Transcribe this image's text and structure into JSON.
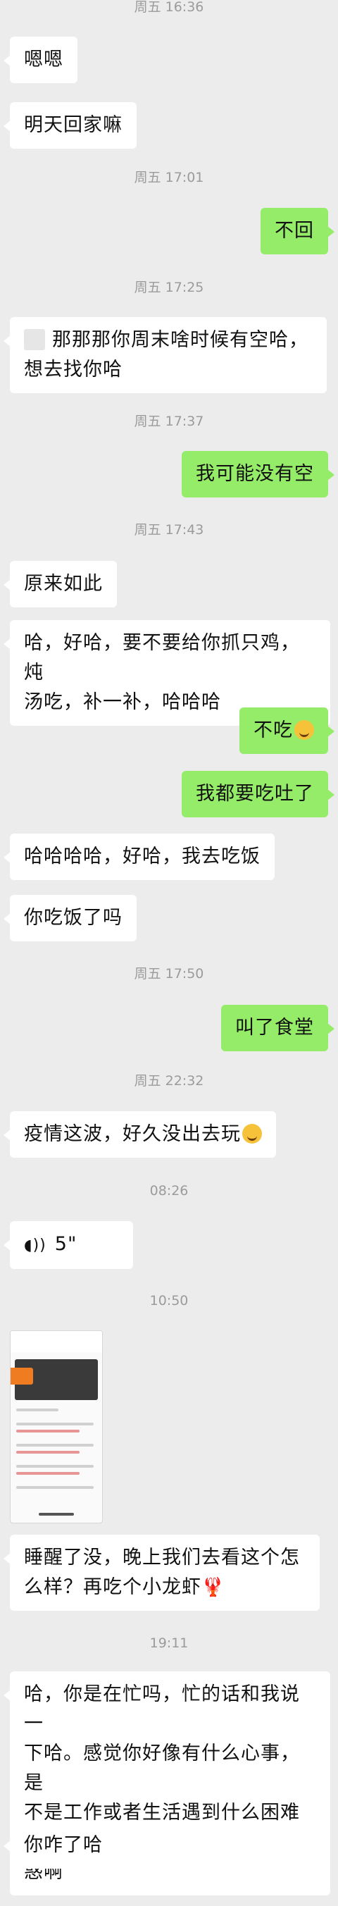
{
  "messages": {
    "ts1": "周五 16:36",
    "m1": "嗯嗯",
    "m2": "明天回家嘛",
    "ts2": "周五 17:01",
    "m3": "不回",
    "ts3": "周五 17:25",
    "m4_line1": "那那那你周末啥时候有空哈，",
    "m4_line2": "想去找你哈",
    "ts4": "周五 17:37",
    "m5": "我可能没有空",
    "ts5": "周五 17:43",
    "m6": "原来如此",
    "m7_line1": "哈，好哈，要不要给你抓只鸡，炖",
    "m7_line2": "汤吃，补一补，哈哈哈",
    "m8": "不吃",
    "m9": "我都要吃吐了",
    "m10": "哈哈哈哈，好哈，我去吃饭",
    "m11": "你吃饭了吗",
    "ts6": "周五 17:50",
    "m12": "叫了食堂",
    "ts7": "周五 22:32",
    "m13": "疫情这波，好久没出去玩",
    "ts8": "08:26",
    "voice_duration": "5\"",
    "ts9": "10:50",
    "m14_line1": "睡醒了没，晚上我们去看这个怎",
    "m14_line2": "么样？再吃个小龙虾",
    "ts10": "19:11",
    "m15_line1": "哈，你是在忙吗，忙的话和我说一",
    "m15_line2": "下哈。感觉你好像有什么心事，是",
    "m15_line3": "不是工作或者生活遇到什么困难困",
    "m15_line4": "惑啊",
    "m16": "你咋了哈"
  },
  "icons": {
    "voice": "voice-wave-icon",
    "emoji_grin": "grin-emoji-icon",
    "emoji_smile": "smile-emoji-icon",
    "lobster": "lobster-emoji-icon"
  },
  "colors": {
    "background": "#ececec",
    "incoming": "#ffffff",
    "outgoing": "#95ec69",
    "timestamp": "#9b9b9b"
  }
}
